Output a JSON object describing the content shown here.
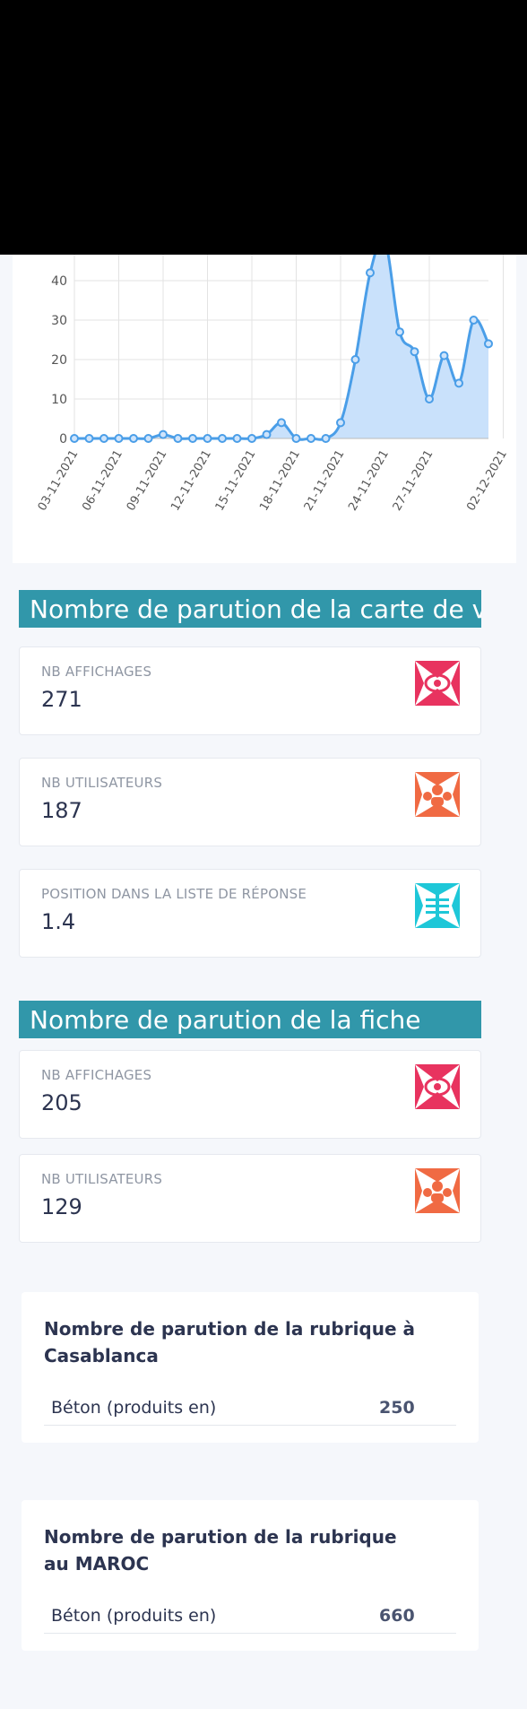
{
  "chart_data": {
    "type": "area",
    "color": "#4a9ee8",
    "fill": "#c9e1fb",
    "categories": [
      "03-11-2021",
      "04-11-2021",
      "05-11-2021",
      "06-11-2021",
      "07-11-2021",
      "08-11-2021",
      "09-11-2021",
      "10-11-2021",
      "11-11-2021",
      "12-11-2021",
      "13-11-2021",
      "14-11-2021",
      "15-11-2021",
      "16-11-2021",
      "17-11-2021",
      "18-11-2021",
      "19-11-2021",
      "20-11-2021",
      "21-11-2021",
      "22-11-2021",
      "23-11-2021",
      "24-11-2021",
      "25-11-2021",
      "26-11-2021",
      "27-11-2021",
      "28-11-2021",
      "29-11-2021",
      "30-11-2021",
      "01-12-2021",
      "02-12-2021"
    ],
    "tick_labels": [
      "03-11-2021",
      "06-11-2021",
      "09-11-2021",
      "12-11-2021",
      "15-11-2021",
      "18-11-2021",
      "21-11-2021",
      "24-11-2021",
      "27-11-2021",
      "02-12-2021"
    ],
    "values": [
      0,
      0,
      0,
      0,
      0,
      0,
      1,
      0,
      0,
      0,
      0,
      0,
      0,
      1,
      4,
      0,
      0,
      0,
      4,
      20,
      42,
      50,
      27,
      22,
      10,
      21,
      14,
      30,
      24
    ],
    "y_ticks": [
      0,
      10,
      20,
      30,
      40
    ],
    "ylim": [
      0,
      45
    ]
  },
  "section1": {
    "title": "Nombre de parution de la carte de viste",
    "cards": [
      {
        "label": "NB AFFICHAGES",
        "value": "271",
        "icon": "eye-icon",
        "color": "#e8335f"
      },
      {
        "label": "NB UTILISATEURS",
        "value": "187",
        "icon": "users-icon",
        "color": "#f06a43"
      },
      {
        "label": "POSITION DANS LA LISTE DE RÉPONSE",
        "value": "1.4",
        "icon": "list-icon",
        "color": "#1ec7d8"
      }
    ]
  },
  "section2": {
    "title": "Nombre de parution de la fiche",
    "cards": [
      {
        "label": "NB AFFICHAGES",
        "value": "205",
        "icon": "eye-icon",
        "color": "#e8335f"
      },
      {
        "label": "NB UTILISATEURS",
        "value": "129",
        "icon": "users-icon",
        "color": "#f06a43"
      }
    ]
  },
  "table_casablanca": {
    "title": "Nombre de parution de la rubrique à Casablanca",
    "rows": [
      {
        "name": "Béton (produits en)",
        "value": "250"
      }
    ]
  },
  "table_maroc": {
    "title": "Nombre de parution de la rubrique au MAROC",
    "rows": [
      {
        "name": "Béton (produits en)",
        "value": "660"
      }
    ]
  }
}
